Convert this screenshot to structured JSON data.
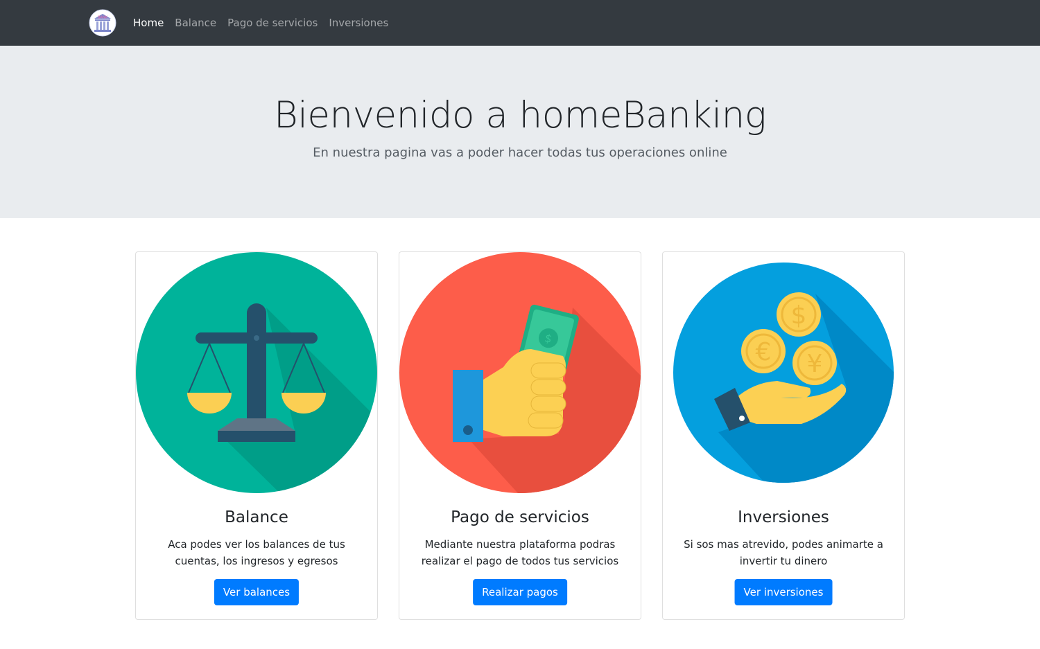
{
  "nav": {
    "logo_text": "BANK",
    "links": [
      {
        "label": "Home",
        "active": true
      },
      {
        "label": "Balance",
        "active": false
      },
      {
        "label": "Pago de servicios",
        "active": false
      },
      {
        "label": "Inversiones",
        "active": false
      }
    ]
  },
  "hero": {
    "title": "Bienvenido a homeBanking",
    "subtitle": "En nuestra pagina vas a poder hacer todas tus operaciones online"
  },
  "cards": [
    {
      "title": "Balance",
      "text": "Aca podes ver los balances de tus cuentas, los ingresos y egresos",
      "button": "Ver balances",
      "icon": "scale-icon",
      "color": "#00b39a"
    },
    {
      "title": "Pago de servicios",
      "text": "Mediante nuestra plataforma podras realizar el pago de todos tus servicios",
      "button": "Realizar pagos",
      "icon": "hand-money-icon",
      "color": "#fd5d4a"
    },
    {
      "title": "Inversiones",
      "text": "Si sos mas atrevido, podes animarte a invertir tu dinero",
      "button": "Ver inversiones",
      "icon": "coins-hand-icon",
      "color": "#049fde"
    }
  ],
  "colors": {
    "navbar": "#343a40",
    "jumbotron": "#e9ecef",
    "primary": "#007bff"
  }
}
